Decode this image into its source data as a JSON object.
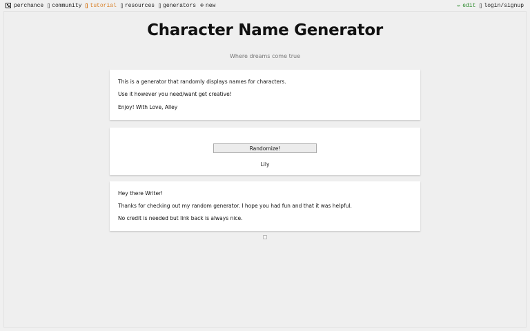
{
  "nav": {
    "logo": "perchance",
    "community": "community",
    "tutorial": "tutorial",
    "resources": "resources",
    "generators": "generators",
    "new": "new",
    "new_icon": "⊕",
    "edit": "edit",
    "edit_icon": "✏",
    "login": "login/signup"
  },
  "page": {
    "title": "Character Name Generator",
    "subtitle": "Where dreams come true"
  },
  "intro_card": {
    "line1": "This is a generator that randomly displays names for characters.",
    "line2": "Use it however you need/want get creative!",
    "line3": "Enjoy! With Love, Alley"
  },
  "generator_card": {
    "button_label": "Randomize!",
    "result": "Lily"
  },
  "outro_card": {
    "line1": "Hey there Writer!",
    "line2": "Thanks for checking out my random generator. I hope you had fun and that it was helpful.",
    "line3": "No credit is needed but link back is always nice."
  },
  "colors": {
    "tutorial": "#d9822b",
    "edit": "#2e8b2e",
    "background": "#f0f0f0"
  }
}
